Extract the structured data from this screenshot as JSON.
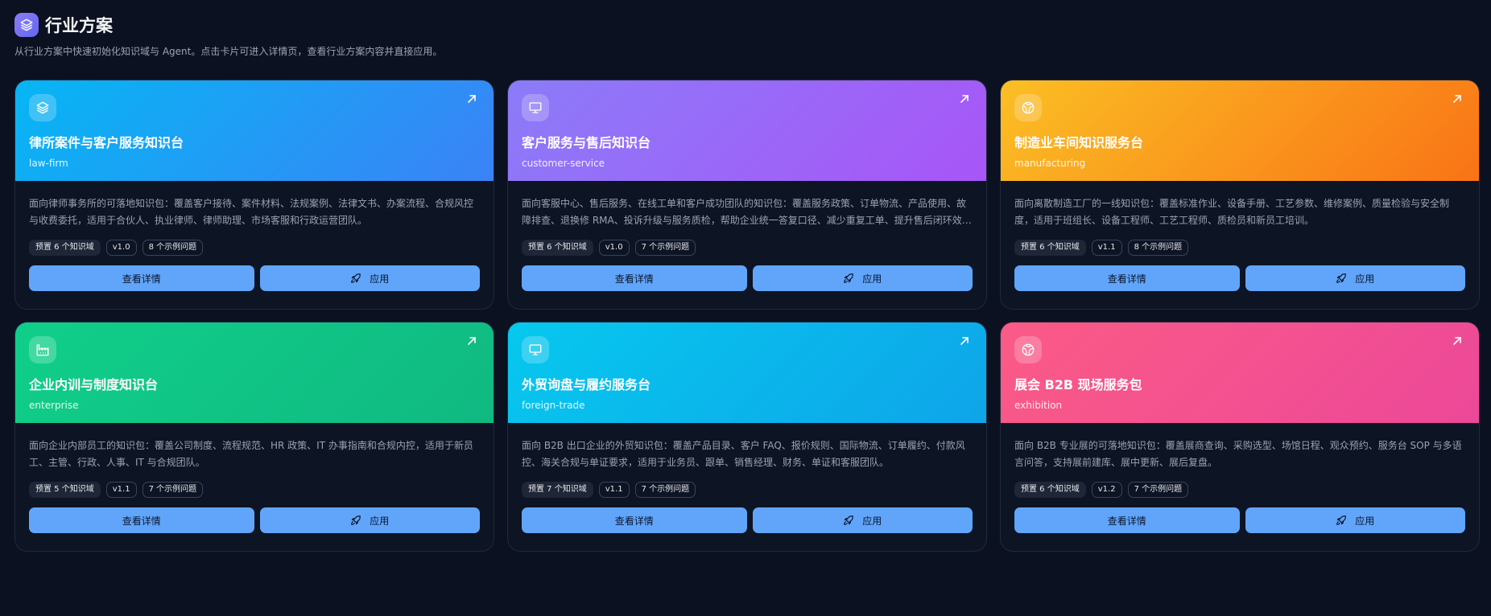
{
  "header": {
    "title": "行业方案",
    "subtitle": "从行业方案中快速初始化知识域与 Agent。点击卡片可进入详情页，查看行业方案内容并直接应用。",
    "logo_icon": "layers-icon",
    "logo_color": "#7c6cf0"
  },
  "cards": [
    {
      "key": "law-firm",
      "title": "律所案件与客户服务知识台",
      "slug": "law-firm",
      "icon": "layers-icon",
      "gradient": [
        "#06b6f4",
        "#3b82f6"
      ],
      "description": "面向律师事务所的可落地知识包：覆盖客户接待、案件材料、法规案例、法律文书、办案流程、合规风控与收费委托，适用于合伙人、执业律师、律师助理、市场客服和行政运营团队。",
      "domains": "预置 6 个知识域",
      "version": "v1.0",
      "examples": "8 个示例问题",
      "detail_label": "查看详情",
      "apply_label": "应用"
    },
    {
      "key": "customer-service",
      "title": "客户服务与售后知识台",
      "slug": "customer-service",
      "icon": "presentation-icon",
      "gradient": [
        "#8b7cf8",
        "#a855f7"
      ],
      "description": "面向客服中心、售后服务、在线工单和客户成功团队的知识包：覆盖服务政策、订单物流、产品使用、故障排查、退换修 RMA、投诉升级与服务质检，帮助企业统一答复口径、减少重复工单、提升售后闭环效率。",
      "domains": "预置 6 个知识域",
      "version": "v1.0",
      "examples": "7 个示例问题",
      "detail_label": "查看详情",
      "apply_label": "应用"
    },
    {
      "key": "manufacturing",
      "title": "制造业车间知识服务台",
      "slug": "manufacturing",
      "icon": "globe-icon",
      "gradient": [
        "#fbbf24",
        "#f97316"
      ],
      "description": "面向离散制造工厂的一线知识包：覆盖标准作业、设备手册、工艺参数、维修案例、质量检验与安全制度，适用于班组长、设备工程师、工艺工程师、质检员和新员工培训。",
      "domains": "预置 6 个知识域",
      "version": "v1.1",
      "examples": "8 个示例问题",
      "detail_label": "查看详情",
      "apply_label": "应用"
    },
    {
      "key": "enterprise",
      "title": "企业内训与制度知识台",
      "slug": "enterprise",
      "icon": "factory-icon",
      "gradient": [
        "#10cf8a",
        "#10b981"
      ],
      "description": "面向企业内部员工的知识包：覆盖公司制度、流程规范、HR 政策、IT 办事指南和合规内控，适用于新员工、主管、行政、人事、IT 与合规团队。",
      "domains": "预置 5 个知识域",
      "version": "v1.1",
      "examples": "7 个示例问题",
      "detail_label": "查看详情",
      "apply_label": "应用"
    },
    {
      "key": "foreign-trade",
      "title": "外贸询盘与履约服务台",
      "slug": "foreign-trade",
      "icon": "screen-icon",
      "gradient": [
        "#06c8ee",
        "#0ea5e9"
      ],
      "description": "面向 B2B 出口企业的外贸知识包：覆盖产品目录、客户 FAQ、报价规则、国际物流、订单履约、付款风控、海关合规与单证要求，适用于业务员、跟单、销售经理、财务、单证和客服团队。",
      "domains": "预置 7 个知识域",
      "version": "v1.1",
      "examples": "7 个示例问题",
      "detail_label": "查看详情",
      "apply_label": "应用"
    },
    {
      "key": "exhibition",
      "title": "展会 B2B 现场服务包",
      "slug": "exhibition",
      "icon": "globe-icon",
      "gradient": [
        "#fb5b86",
        "#ec4899"
      ],
      "description": "面向 B2B 专业展的可落地知识包：覆盖展商查询、采购选型、场馆日程、观众预约、服务台 SOP 与多语言问答，支持展前建库、展中更新、展后复盘。",
      "domains": "预置 6 个知识域",
      "version": "v1.2",
      "examples": "7 个示例问题",
      "detail_label": "查看详情",
      "apply_label": "应用"
    }
  ]
}
